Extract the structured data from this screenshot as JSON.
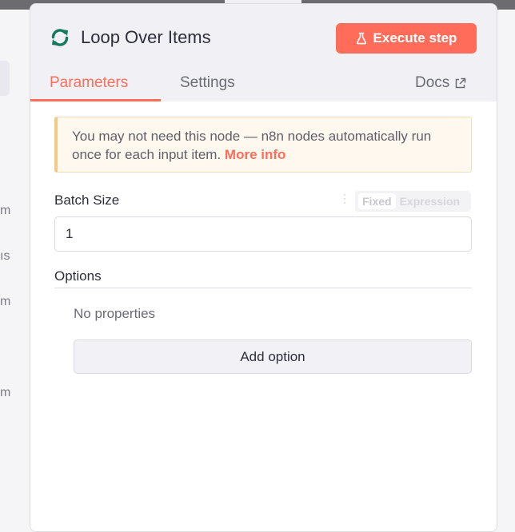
{
  "node": {
    "title": "Loop Over Items",
    "execute_label": "Execute step"
  },
  "tabs": {
    "parameters": "Parameters",
    "settings": "Settings",
    "docs": "Docs"
  },
  "notice": {
    "text": "You may not need this node — n8n nodes automatically run once for each input item.",
    "link": "More info"
  },
  "batch_size": {
    "label": "Batch Size",
    "value": "1",
    "mode_fixed": "Fixed",
    "mode_expression": "Expression"
  },
  "options": {
    "label": "Options",
    "empty_text": "No properties",
    "add_label": "Add option"
  },
  "background": {
    "fragments": [
      "m",
      "ıs",
      "m",
      "m"
    ]
  },
  "colors": {
    "accent": "#ff6d5a",
    "icon": "#147a5e"
  }
}
